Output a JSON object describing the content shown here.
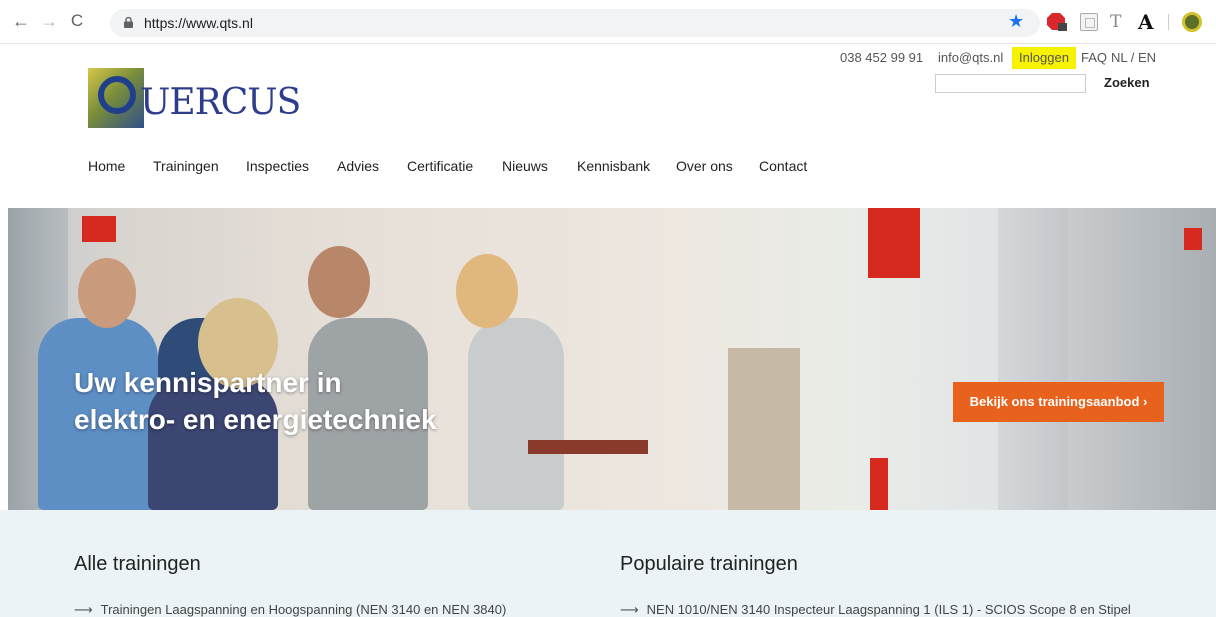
{
  "browser": {
    "url": "https://www.qts.nl"
  },
  "header": {
    "phone": "038 452 99 91",
    "email": "info@qts.nl",
    "login": "Inloggen",
    "faq": "FAQ",
    "language": "NL / EN",
    "search_placeholder": "",
    "search_button": "Zoeken",
    "logo_text": "UERCUS"
  },
  "nav": {
    "items": [
      "Home",
      "Trainingen",
      "Inspecties",
      "Advies",
      "Certificatie",
      "Nieuws",
      "Kennisbank",
      "Over ons",
      "Contact"
    ]
  },
  "hero": {
    "title_line1": "Uw kennispartner in",
    "title_line2": "elektro- en energietechniek",
    "cta": "Bekijk ons trainingsaanbod ›"
  },
  "sections": {
    "all_trainings": {
      "title": "Alle trainingen",
      "first_link": "Trainingen Laagspanning en Hoogspanning (NEN 3140 en NEN 3840)"
    },
    "popular_trainings": {
      "title": "Populaire trainingen",
      "first_link": "NEN 1010/NEN 3140 Inspecteur Laagspanning 1 (ILS 1) - SCIOS Scope 8 en Stipel"
    },
    "arrow": "⟶"
  },
  "colors": {
    "login_highlight": "#f7f300",
    "cta": "#e8611d",
    "logo_blue": "#2d3d8c",
    "lower_bg": "#ebf3f6"
  }
}
